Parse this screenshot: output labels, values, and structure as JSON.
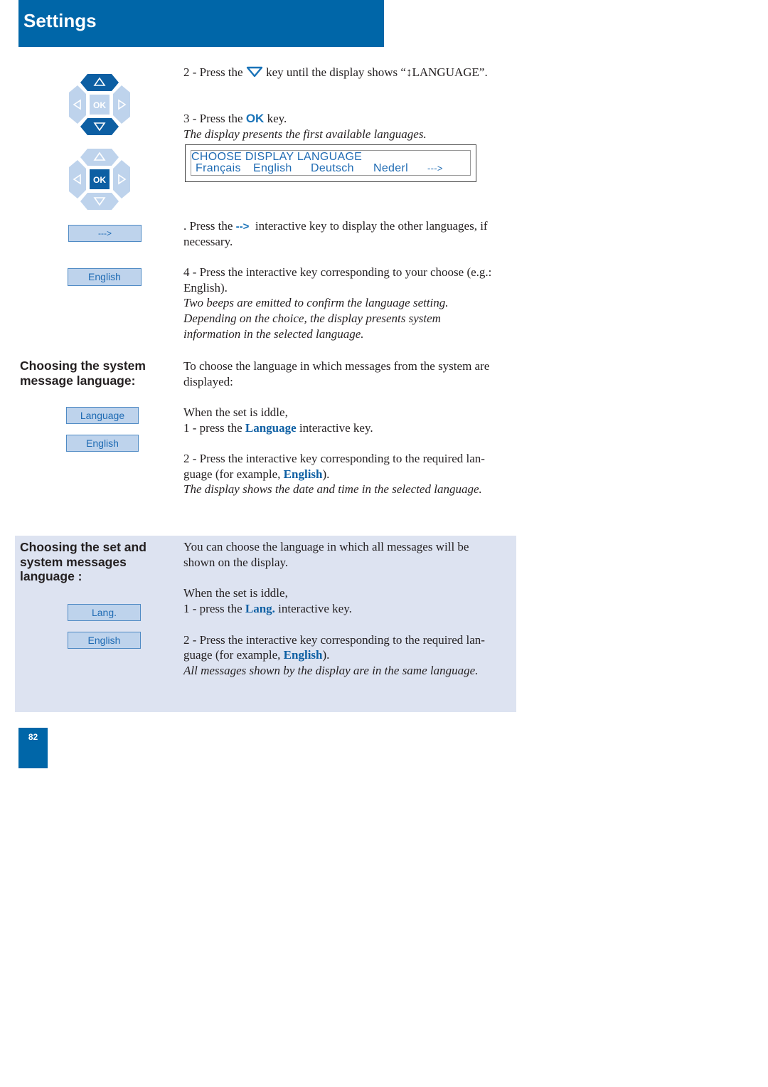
{
  "header": {
    "title": "Settings",
    "color": "#0066a8"
  },
  "dpads": [
    {
      "name": "dpad-nav",
      "highlighted": [
        "up",
        "down"
      ],
      "ok_label": "OK"
    },
    {
      "name": "dpad-ok",
      "highlighted": [
        "ok"
      ],
      "ok_label": "OK"
    }
  ],
  "step2": {
    "prefix": "2 - Press the ",
    "suffix": " key until the display shows “↕LANGUAGE”."
  },
  "step3": {
    "prefix": "3 - Press the ",
    "ok_glyph": "OK",
    "suffix": " key.",
    "note": "The display presents the first available languages."
  },
  "lcd": {
    "line1": "CHOOSE DISPLAY LANGUAGE",
    "options": [
      "Français",
      "English",
      "Deutsch",
      "Nederl",
      "--->"
    ]
  },
  "softkeys_top": {
    "next": "--->",
    "english": "English"
  },
  "step_next": {
    "prefix": ". Press the ",
    "key": "-->",
    "suffix": "  interactive key to display the other languages, if",
    "line2": "necessary."
  },
  "step4": {
    "line1": "4 - Press the interactive key corresponding to your choose (e.g.:",
    "line2": "English).",
    "notes": [
      "Two beeps are emitted to confirm the language setting.",
      "Depending on the choice, the display presents system",
      "information in the selected language."
    ]
  },
  "section_system": {
    "heading_line1": "Choosing the system",
    "heading_line2": "message language:",
    "softkeys": [
      "Language",
      "English"
    ],
    "intro_line1": "To choose the language in which messages from the system are",
    "intro_line2": "displayed:",
    "idle": "When the set is iddle,",
    "step1_prefix": "1 - press the ",
    "step1_key": "Language",
    "step1_suffix": " interactive key.",
    "step2_line1": "2 - Press the interactive key corresponding to the required lan-",
    "step2_prefix": "guage (for example, ",
    "step2_key": "English",
    "step2_suffix": ").",
    "note": "The display shows the date and time in the selected language."
  },
  "section_set": {
    "heading_line1": "Choosing the set and",
    "heading_line2": "system messages",
    "heading_line3": "language :",
    "softkeys": [
      "Lang.",
      "English"
    ],
    "intro_line1": "You can choose the language in which all messages will be",
    "intro_line2": "shown on the display.",
    "idle": "When the set is iddle,",
    "step1_prefix": "1 - press the ",
    "step1_key": "Lang.",
    "step1_suffix": " interactive key.",
    "step2_line1": "2 - Press the interactive key corresponding to the required lan-",
    "step2_prefix": "guage (for example, ",
    "step2_key": "English",
    "step2_suffix": ").",
    "note": "All messages shown by the display are in the same language.",
    "background": "#dde3f1"
  },
  "footer": {
    "page_number": "82"
  }
}
